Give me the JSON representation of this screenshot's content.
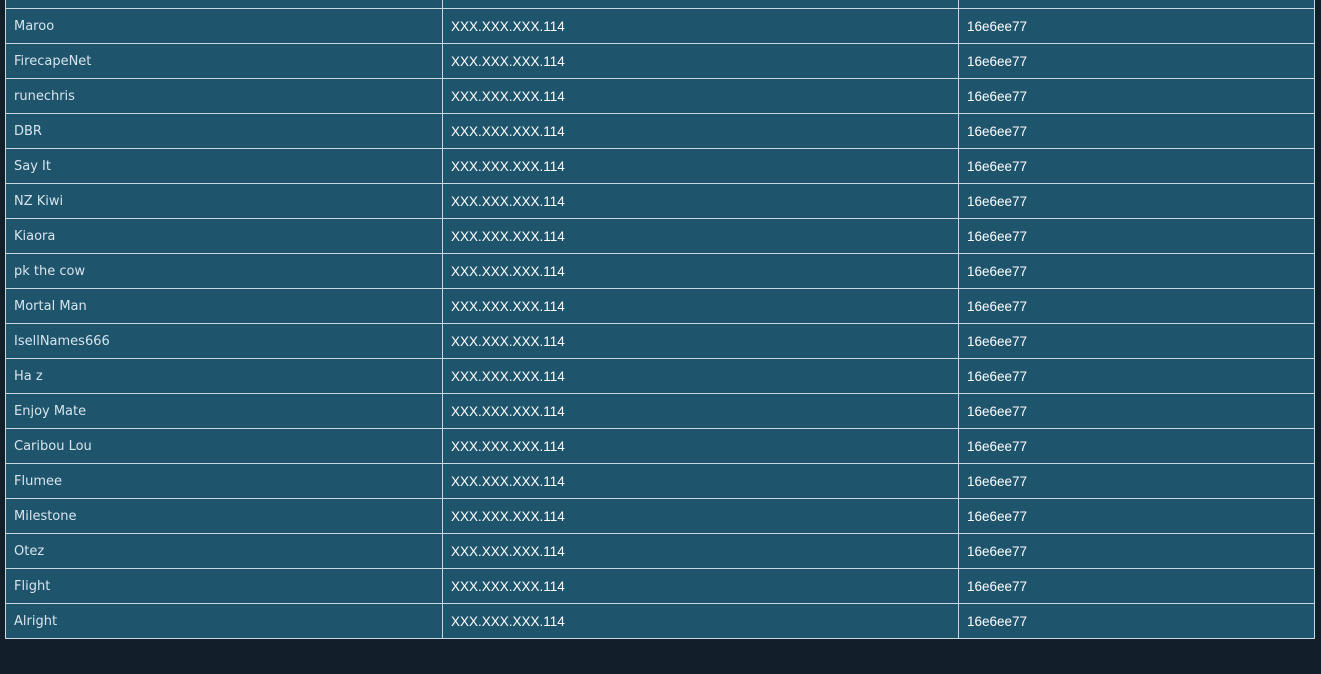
{
  "players_table": {
    "rows": [
      {
        "name": "",
        "ip": "",
        "id": ""
      },
      {
        "name": "Maroo",
        "ip": "XXX.XXX.XXX.114",
        "id": "16e6ee77"
      },
      {
        "name": "FirecapeNet",
        "ip": "XXX.XXX.XXX.114",
        "id": "16e6ee77"
      },
      {
        "name": "runechris",
        "ip": "XXX.XXX.XXX.114",
        "id": "16e6ee77"
      },
      {
        "name": "DBR",
        "ip": "XXX.XXX.XXX.114",
        "id": "16e6ee77"
      },
      {
        "name": "Say It",
        "ip": "XXX.XXX.XXX.114",
        "id": "16e6ee77"
      },
      {
        "name": "NZ Kiwi",
        "ip": "XXX.XXX.XXX.114",
        "id": "16e6ee77"
      },
      {
        "name": "Kiaora",
        "ip": "XXX.XXX.XXX.114",
        "id": "16e6ee77"
      },
      {
        "name": "pk the cow",
        "ip": "XXX.XXX.XXX.114",
        "id": "16e6ee77"
      },
      {
        "name": "Mortal Man",
        "ip": "XXX.XXX.XXX.114",
        "id": "16e6ee77"
      },
      {
        "name": "IsellNames666",
        "ip": "XXX.XXX.XXX.114",
        "id": "16e6ee77"
      },
      {
        "name": "Ha z",
        "ip": "XXX.XXX.XXX.114",
        "id": "16e6ee77"
      },
      {
        "name": "Enjoy Mate",
        "ip": "XXX.XXX.XXX.114",
        "id": "16e6ee77"
      },
      {
        "name": "Caribou Lou",
        "ip": "XXX.XXX.XXX.114",
        "id": "16e6ee77"
      },
      {
        "name": "Flumee",
        "ip": "XXX.XXX.XXX.114",
        "id": "16e6ee77"
      },
      {
        "name": "Milestone",
        "ip": "XXX.XXX.XXX.114",
        "id": "16e6ee77"
      },
      {
        "name": "Otez",
        "ip": "XXX.XXX.XXX.114",
        "id": "16e6ee77"
      },
      {
        "name": "Flight",
        "ip": "XXX.XXX.XXX.114",
        "id": "16e6ee77"
      },
      {
        "name": "Alright",
        "ip": "XXX.XXX.XXX.114",
        "id": "16e6ee77"
      }
    ]
  },
  "colors": {
    "page_background": "#121e2a",
    "row_background": "#1f546d",
    "cell_border": "#c8d6de",
    "name_text": "#d7e4ec",
    "value_text": "#ffffff"
  }
}
